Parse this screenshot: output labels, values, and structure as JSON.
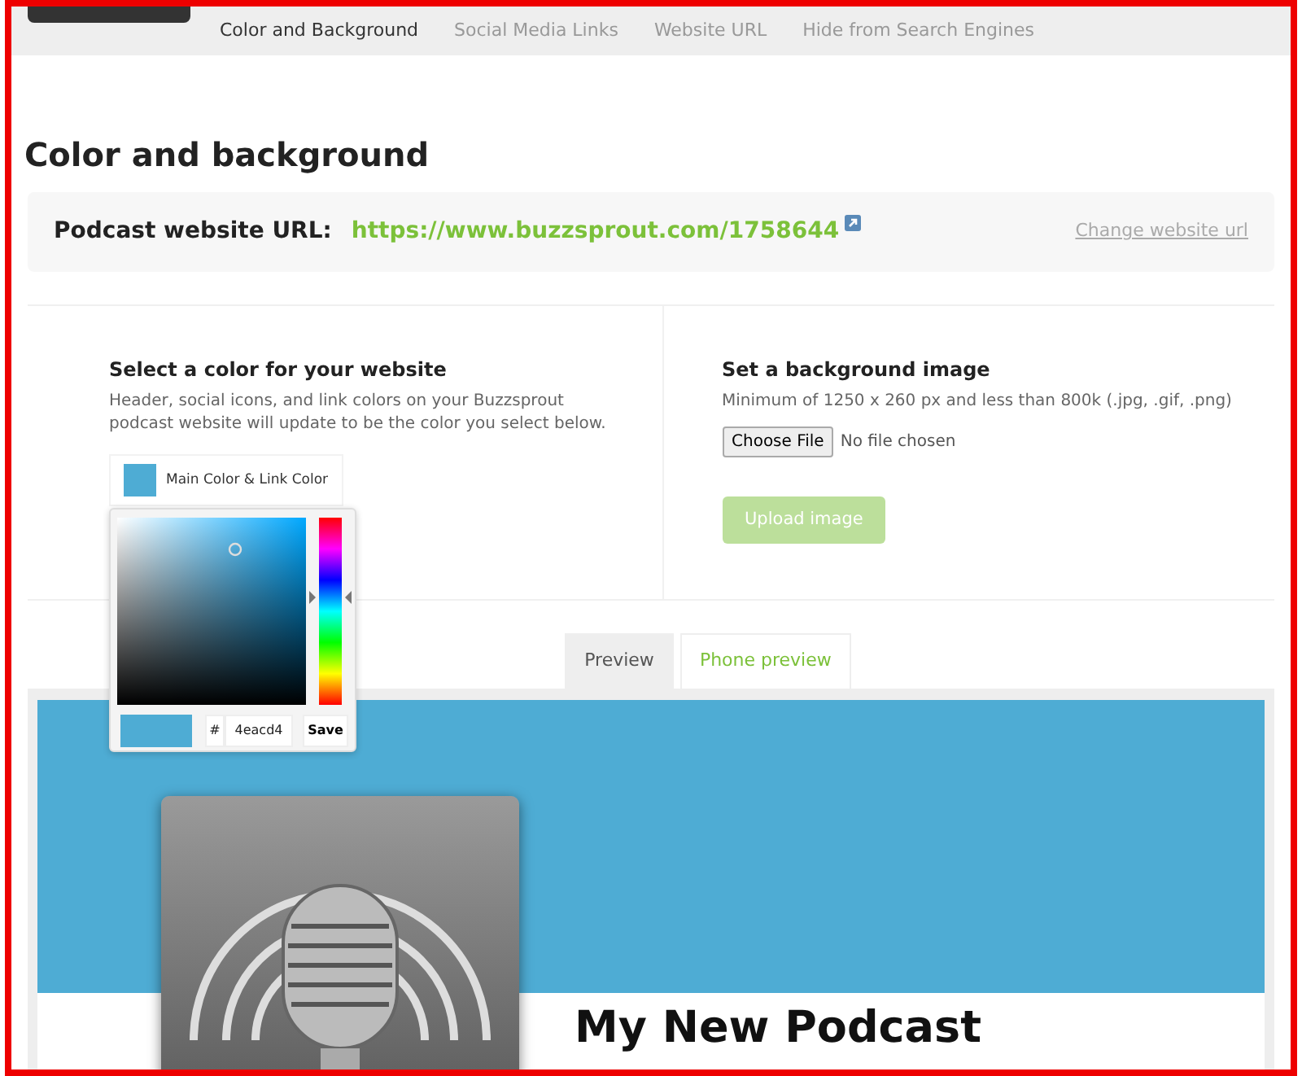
{
  "nav_tabs": [
    {
      "label": "Color and Background",
      "selected": true
    },
    {
      "label": "Social Media Links",
      "selected": false
    },
    {
      "label": "Website URL",
      "selected": false
    },
    {
      "label": "Hide from Search Engines",
      "selected": false
    }
  ],
  "heading": "Color and background",
  "url_panel": {
    "label": "Podcast website URL:",
    "url": "https://www.buzzsprout.com/1758644",
    "change_link": "Change website url"
  },
  "color_section": {
    "title": "Select a color for your website",
    "description": "Header, social icons, and link colors on your Buzzsprout podcast website will update to be the color you select below.",
    "swatch": {
      "label": "Main Color & Link Color",
      "color": "#4eacd4"
    },
    "picker": {
      "hue": {
        "level": 0.57
      },
      "hash": "#",
      "hex": "4eacd4",
      "save": "Save"
    }
  },
  "background_section": {
    "title": "Set a background image",
    "description": "Minimum of 1250 x 260 px and less than 800k (.jpg, .gif, .png)",
    "file_button": "Choose File",
    "file_status": "No file chosen",
    "upload_button": {
      "label": "Upload image",
      "disabled": true
    }
  },
  "preview_tabs": [
    {
      "label": "Preview",
      "selected": true
    },
    {
      "label": "Phone preview",
      "selected": false
    }
  ],
  "preview": {
    "podcast_title": "My New Podcast"
  }
}
